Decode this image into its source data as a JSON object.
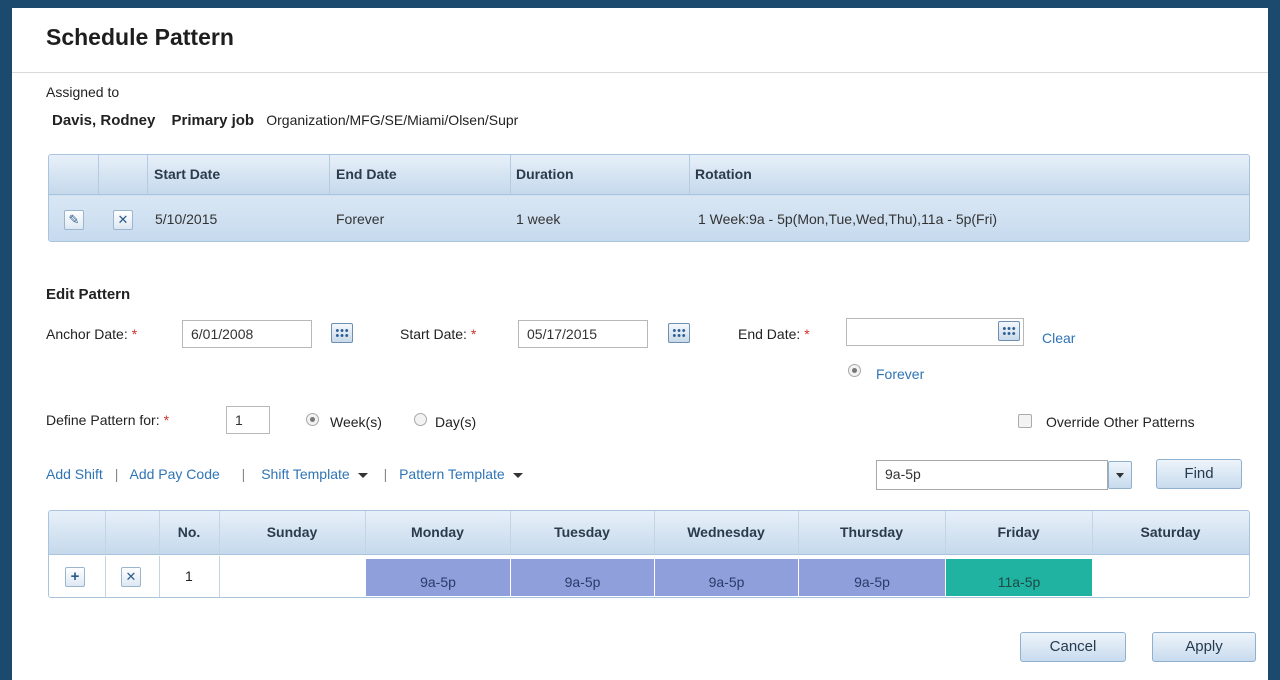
{
  "dialog": {
    "title": "Schedule Pattern"
  },
  "assigned": {
    "label": "Assigned to",
    "name": "Davis, Rodney",
    "primary_job_label": "Primary job",
    "job_path": "Organization/MFG/SE/Miami/Olsen/Supr"
  },
  "assignment_table": {
    "headers": [
      "Start Date",
      "End Date",
      "Duration",
      "Rotation"
    ],
    "rows": [
      {
        "start": "5/10/2015",
        "end": "Forever",
        "duration": "1 week",
        "rotation": "1 Week:9a - 5p(Mon,Tue,Wed,Thu),11a - 5p(Fri)"
      }
    ]
  },
  "edit_pattern": {
    "title": "Edit Pattern",
    "anchor_label": "Anchor Date:",
    "anchor_value": "6/01/2008",
    "start_label": "Start Date:",
    "start_value": "05/17/2015",
    "end_label": "End Date:",
    "end_value": "",
    "clear_label": "Clear",
    "forever_label": "Forever",
    "define_label": "Define Pattern for:",
    "define_value": "1",
    "weeks_label": "Week(s)",
    "days_label": "Day(s)",
    "override_label": "Override Other Patterns",
    "required_mark": "*"
  },
  "toolbar": {
    "add_shift": "Add Shift",
    "add_pay_code": "Add Pay Code",
    "shift_template": "Shift Template",
    "pattern_template": "Pattern Template",
    "separator": "|",
    "search_value": "9a-5p",
    "find_label": "Find"
  },
  "pattern_grid": {
    "headers": {
      "no": "No.",
      "days": [
        "Sunday",
        "Monday",
        "Tuesday",
        "Wednesday",
        "Thursday",
        "Friday",
        "Saturday"
      ]
    },
    "rows": [
      {
        "no": "1",
        "shifts": [
          "",
          "9a-5p",
          "9a-5p",
          "9a-5p",
          "9a-5p",
          "11a-5p",
          ""
        ]
      }
    ],
    "colors": {
      "regular_shift": "#8f9fdb",
      "friday_shift": "#20b3a2"
    }
  },
  "actions": {
    "cancel": "Cancel",
    "apply": "Apply"
  },
  "colors": {
    "frame": "#1b4a6e",
    "link": "#2f74b5",
    "required": "#d0302f"
  }
}
